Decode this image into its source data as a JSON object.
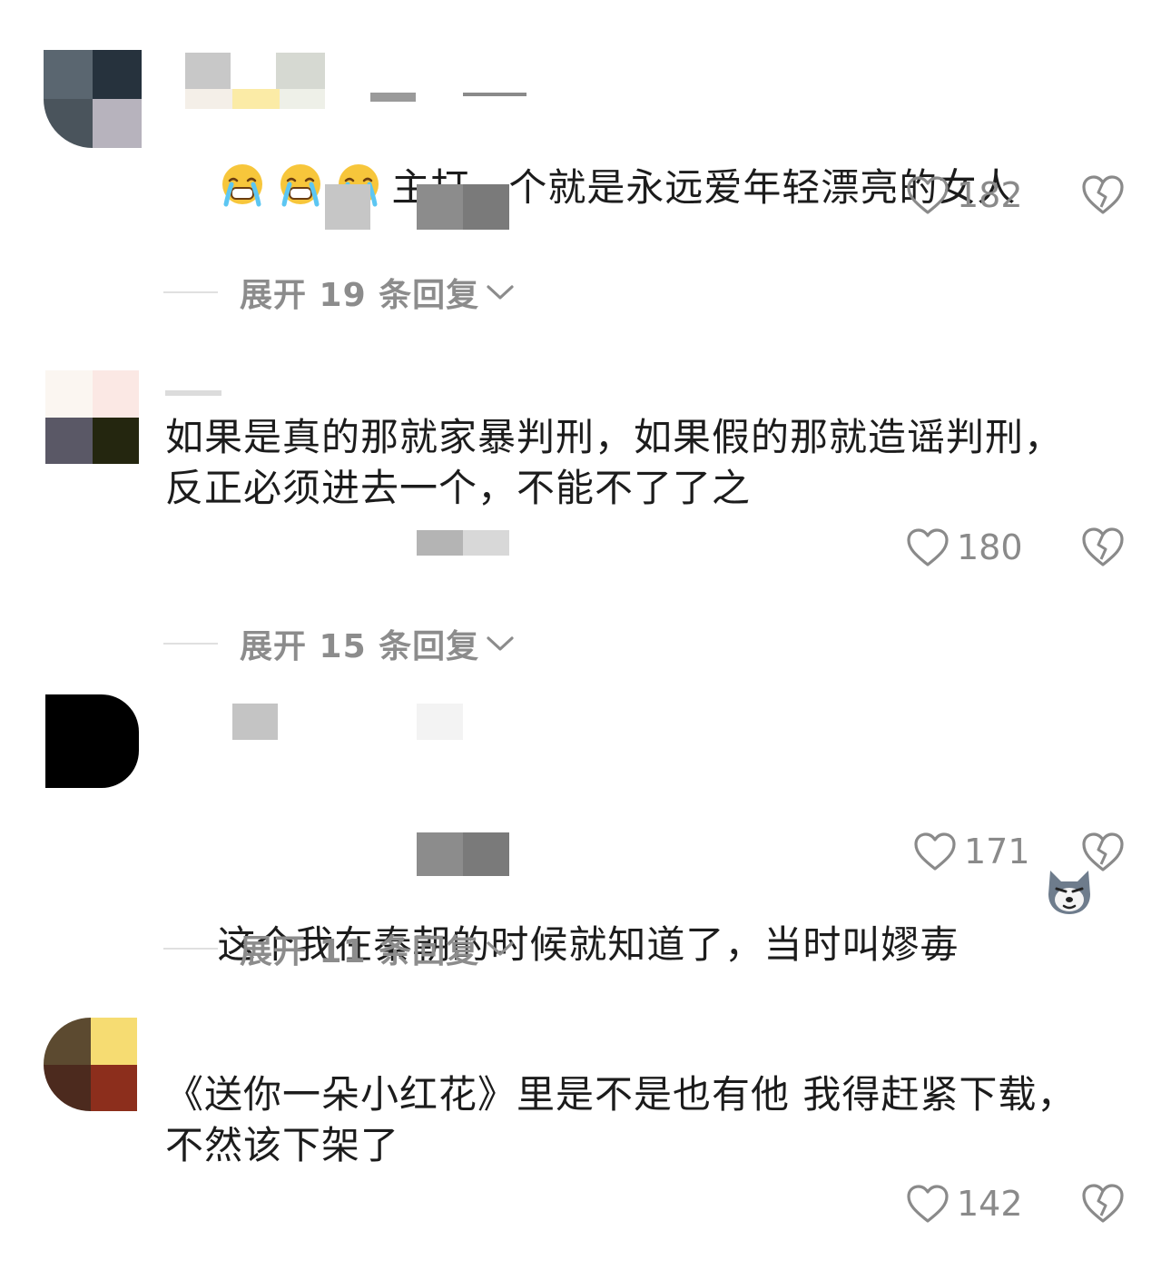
{
  "comments": [
    {
      "text": "主打一个就是永远爱年轻漂亮的女人",
      "emojis": [
        "crying-face-icon",
        "crying-face-icon",
        "crying-face-icon"
      ],
      "likes": "182",
      "expand_label": "展开 19 条回复"
    },
    {
      "text": "如果是真的那就家暴判刑，如果假的那就造谣判刑，\n反正必须进去一个，不能不了了之",
      "likes": "180",
      "expand_label": "展开 15 条回复"
    },
    {
      "text": "这个我在秦朝的时候就知道了，当时叫嫪毐",
      "trailing_emoji": "wolf-face-icon",
      "likes": "171",
      "expand_label": "展开 11 条回复"
    },
    {
      "text": "《送你一朵小红花》里是不是也有他 我得赶紧下载，\n不然该下架了",
      "likes": "142"
    }
  ],
  "colors": {
    "text": "#1c1c1c",
    "muted": "#8a8a8a",
    "icon_stroke": "#8a8a8a"
  }
}
